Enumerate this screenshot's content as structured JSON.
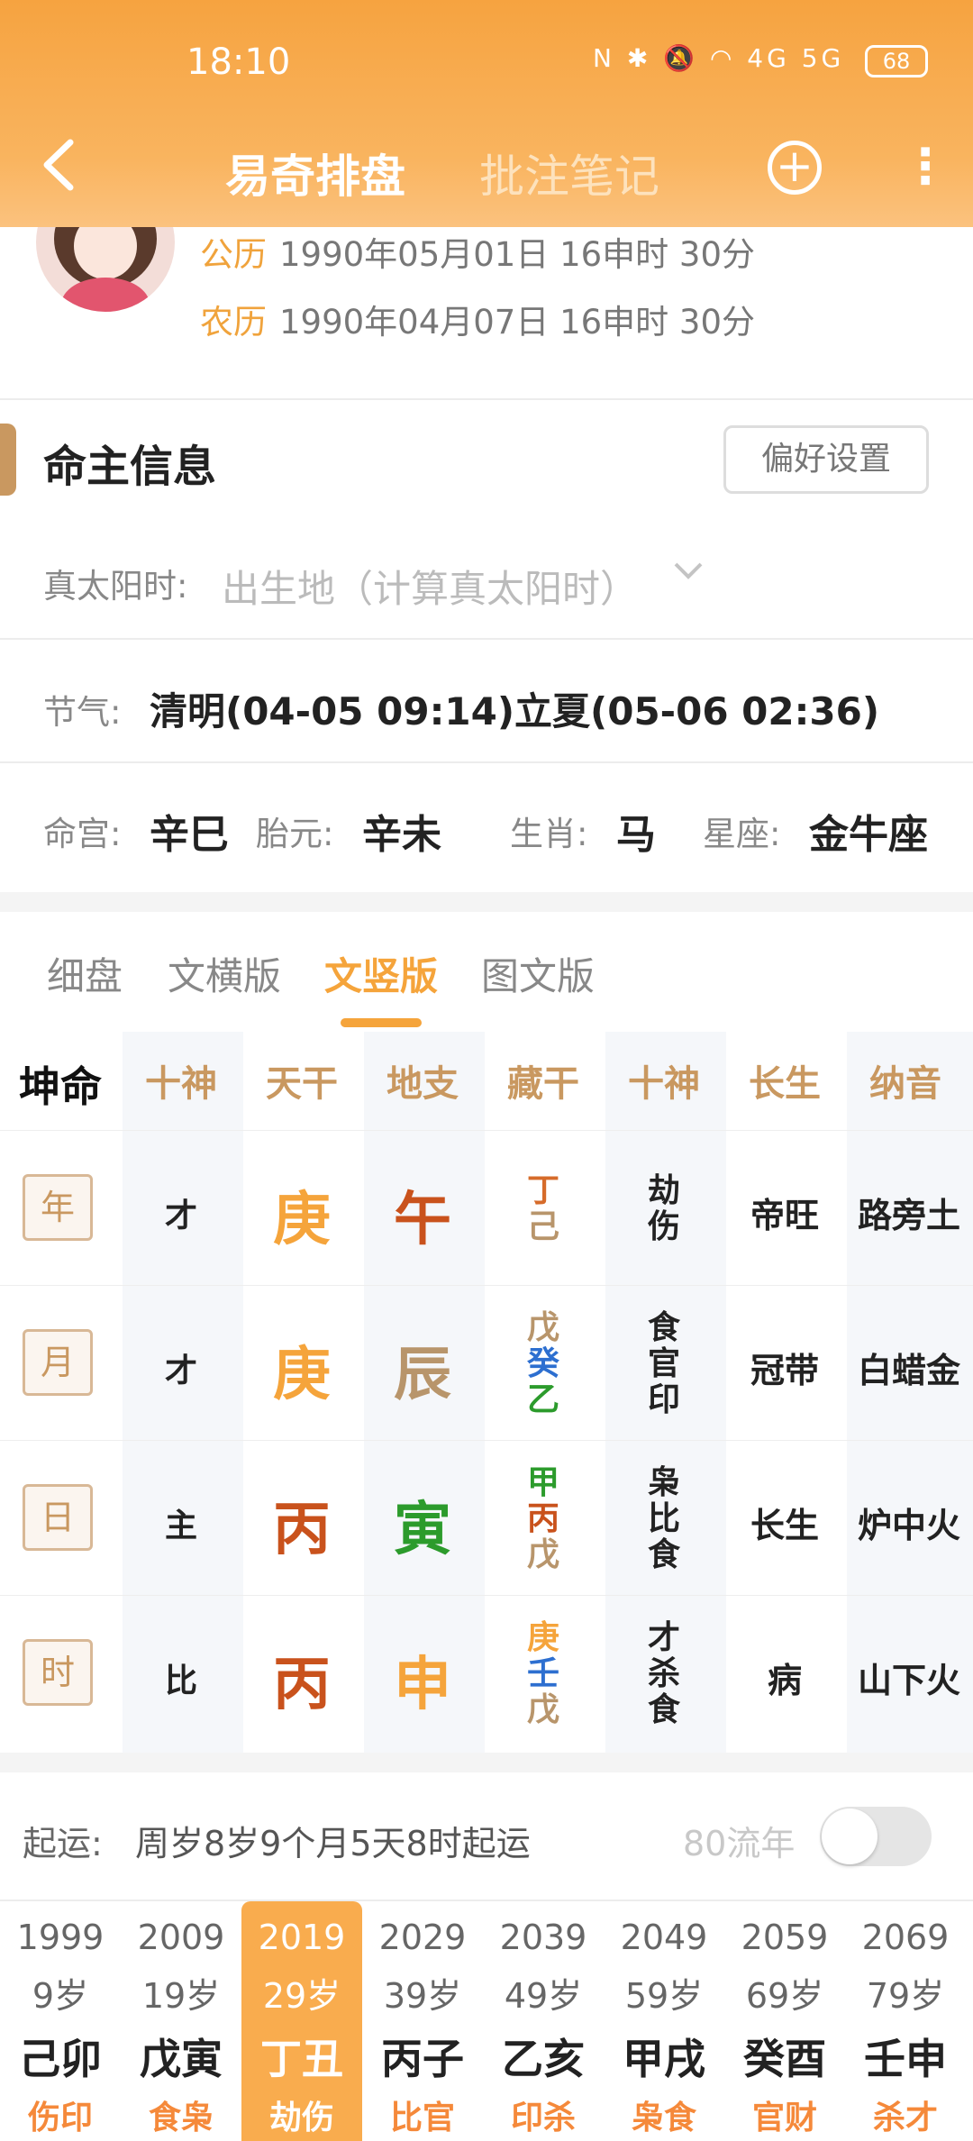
{
  "status": {
    "time": "18:10",
    "icons": "N ✱ 🔕 ◠ 4G 5G",
    "battery": "68"
  },
  "nav": {
    "back_icon": "chevron-left",
    "tab_main": "易奇排盘",
    "tab_notes": "批注笔记",
    "add_icon": "+",
    "more_icon": "⋮"
  },
  "profile": {
    "solar_label": "公历",
    "solar_value": "1990年05月01日 16申时 30分",
    "lunar_label": "农历",
    "lunar_value": "1990年04月07日 16申时 30分"
  },
  "info": {
    "title": "命主信息",
    "pref_button": "偏好设置",
    "tst_label": "真太阳时:",
    "tst_value": "出生地（计算真太阳时）",
    "jieqi_label": "节气:",
    "jieqi_value": "清明(04-05 09:14)立夏(05-06 02:36)",
    "minggong_label": "命宫:",
    "minggong_value": "辛巳",
    "taiyuan_label": "胎元:",
    "taiyuan_value": "辛未",
    "shengxiao_label": "生肖:",
    "shengxiao_value": "马",
    "xingzuo_label": "星座:",
    "xingzuo_value": "金牛座"
  },
  "version_tabs": [
    "细盘",
    "文横版",
    "文竖版",
    "图文版"
  ],
  "chart": {
    "headers": [
      "坤命",
      "十神",
      "天干",
      "地支",
      "藏干",
      "十神",
      "长生",
      "纳音"
    ],
    "rows": [
      {
        "pillar": "年",
        "shishen": "才",
        "gan": "庚",
        "zhi": "午",
        "canggan": [
          "丁",
          "己"
        ],
        "canggan_ss": [
          "劫",
          "伤"
        ],
        "changsheng": "帝旺",
        "nayin": "路旁土"
      },
      {
        "pillar": "月",
        "shishen": "才",
        "gan": "庚",
        "zhi": "辰",
        "canggan": [
          "戊",
          "癸",
          "乙"
        ],
        "canggan_ss": [
          "食",
          "官",
          "印"
        ],
        "changsheng": "冠带",
        "nayin": "白蜡金"
      },
      {
        "pillar": "日",
        "shishen": "主",
        "gan": "丙",
        "zhi": "寅",
        "canggan": [
          "甲",
          "丙",
          "戊"
        ],
        "canggan_ss": [
          "枭",
          "比",
          "食"
        ],
        "changsheng": "长生",
        "nayin": "炉中火"
      },
      {
        "pillar": "时",
        "shishen": "比",
        "gan": "丙",
        "zhi": "申",
        "canggan": [
          "庚",
          "壬",
          "戊"
        ],
        "canggan_ss": [
          "才",
          "杀",
          "食"
        ],
        "changsheng": "病",
        "nayin": "山下火"
      }
    ],
    "colors": {
      "metal": "#f5a43b",
      "fire": "#c9521c",
      "earth": "#b8956b",
      "water": "#2d6fd0",
      "wood": "#2c9b2c",
      "fire_light": "#d66b2a"
    }
  },
  "qiyun": {
    "label": "起运:",
    "value": "周岁8岁9个月5天8时起运",
    "liunian_label": "80流年",
    "toggle_on": false
  },
  "dayun": [
    {
      "year": "1999",
      "age": "9岁",
      "gz": "己卯",
      "ss": "伤印"
    },
    {
      "year": "2009",
      "age": "19岁",
      "gz": "戊寅",
      "ss": "食枭"
    },
    {
      "year": "2019",
      "age": "29岁",
      "gz": "丁丑",
      "ss": "劫伤",
      "active": true
    },
    {
      "year": "2029",
      "age": "39岁",
      "gz": "丙子",
      "ss": "比官"
    },
    {
      "year": "2039",
      "age": "49岁",
      "gz": "乙亥",
      "ss": "印杀"
    },
    {
      "year": "2049",
      "age": "59岁",
      "gz": "甲戌",
      "ss": "枭食"
    },
    {
      "year": "2059",
      "age": "69岁",
      "gz": "癸酉",
      "ss": "官财"
    },
    {
      "year": "2069",
      "age": "79岁",
      "gz": "壬申",
      "ss": "杀才"
    }
  ]
}
